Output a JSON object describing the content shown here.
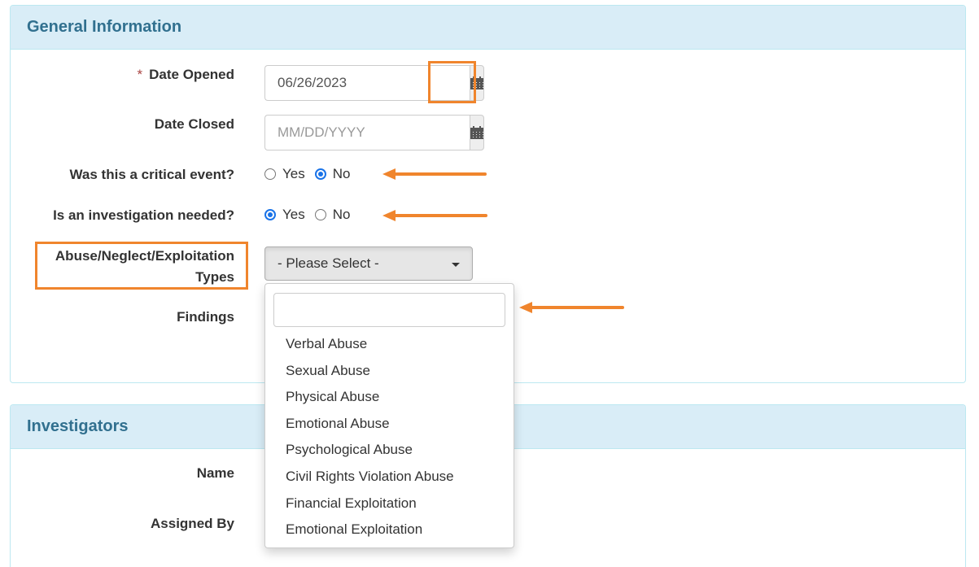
{
  "general": {
    "title": "General Information",
    "date_opened": {
      "required_marker": "*",
      "label": "Date Opened",
      "value": "06/26/2023",
      "icon": "calendar-icon"
    },
    "date_closed": {
      "label": "Date Closed",
      "value": "",
      "placeholder": "MM/DD/YYYY",
      "icon": "calendar-icon"
    },
    "critical_event": {
      "label": "Was this a critical event?",
      "options": [
        {
          "label": "Yes",
          "checked": false
        },
        {
          "label": "No",
          "checked": true
        }
      ]
    },
    "investigation_needed": {
      "label": "Is an investigation needed?",
      "options": [
        {
          "label": "Yes",
          "checked": true
        },
        {
          "label": "No",
          "checked": false
        }
      ]
    },
    "types": {
      "label_line1": "Abuse/Neglect/Exploitation",
      "label_line2": "Types",
      "selected": "- Please Select -",
      "search_value": "",
      "options": [
        "Verbal Abuse",
        "Sexual Abuse",
        "Physical Abuse",
        "Emotional Abuse",
        "Psychological Abuse",
        "Civil Rights Violation Abuse",
        "Financial Exploitation",
        "Emotional Exploitation"
      ]
    },
    "findings": {
      "label": "Findings"
    }
  },
  "investigators": {
    "title": "Investigators",
    "name": {
      "label": "Name"
    },
    "assigned_by": {
      "label": "Assigned By"
    }
  },
  "annotation_color": "#f0852d"
}
